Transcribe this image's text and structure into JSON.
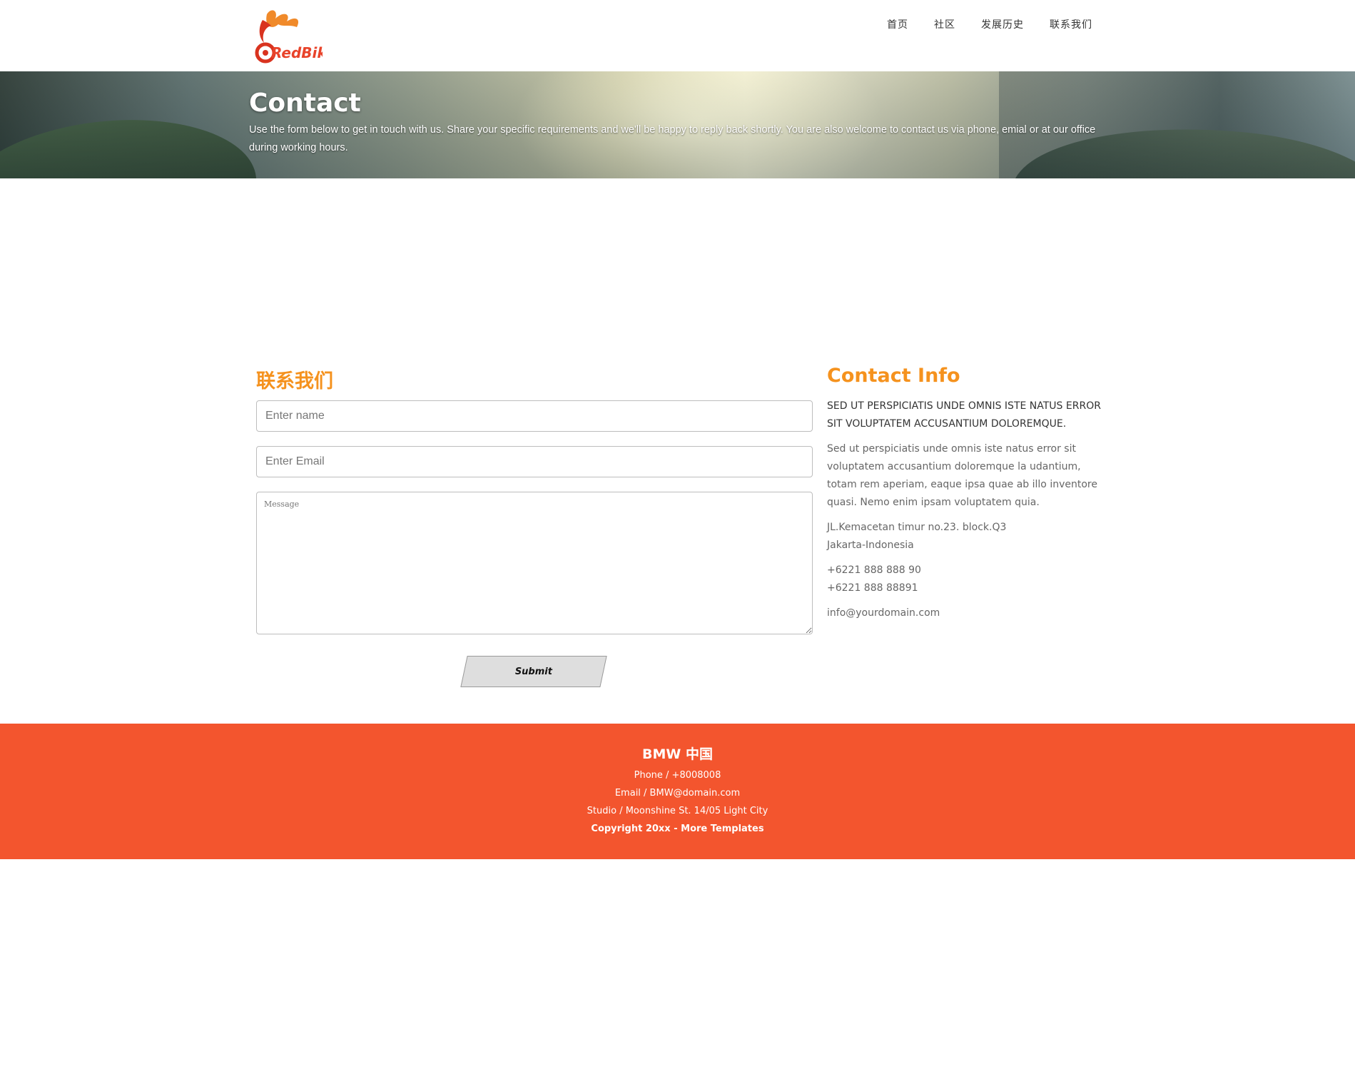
{
  "header": {
    "logo_text": "RedBiker",
    "nav": [
      {
        "label": "首页"
      },
      {
        "label": "社区"
      },
      {
        "label": "发展历史"
      },
      {
        "label": "联系我们"
      }
    ]
  },
  "banner": {
    "title": "Contact",
    "text": "Use the form below to get in touch with us. Share your specific requirements and we'll be happy to reply back shortly. You are also welcome to contact us via phone, emial or at our office during working hours."
  },
  "form": {
    "title": "联系我们",
    "name_placeholder": "Enter name",
    "email_placeholder": "Enter Email",
    "message_placeholder": "Message",
    "submit_label": "Submit"
  },
  "contact_info": {
    "title": "Contact Info",
    "lead": "SED UT PERSPICIATIS UNDE OMNIS ISTE NATUS ERROR SIT VOLUPTATEM ACCUSANTIUM DOLOREMQUE.",
    "description": "Sed ut perspiciatis unde omnis iste natus error sit voluptatem accusantium doloremque la udantium, totam rem aperiam, eaque ipsa quae ab illo inventore quasi. Nemo enim ipsam voluptatem quia.",
    "address_line1": "JL.Kemacetan timur no.23. block.Q3",
    "address_line2": "Jakarta-Indonesia",
    "phone1": "+6221 888 888 90",
    "phone2": "+6221 888 88891",
    "email": "info@yourdomain.com"
  },
  "footer": {
    "brand": "BMW 中国",
    "phone": "Phone / +8008008",
    "email": "Email / BMW@domain.com",
    "address": "Studio / Moonshine St. 14/05 Light City",
    "copyright_prefix": "Copyright 20xx - ",
    "copyright_link": "More Templates"
  },
  "colors": {
    "accent_orange": "#f5921e",
    "footer_red": "#f3552e",
    "logo_red": "#e8432a"
  }
}
